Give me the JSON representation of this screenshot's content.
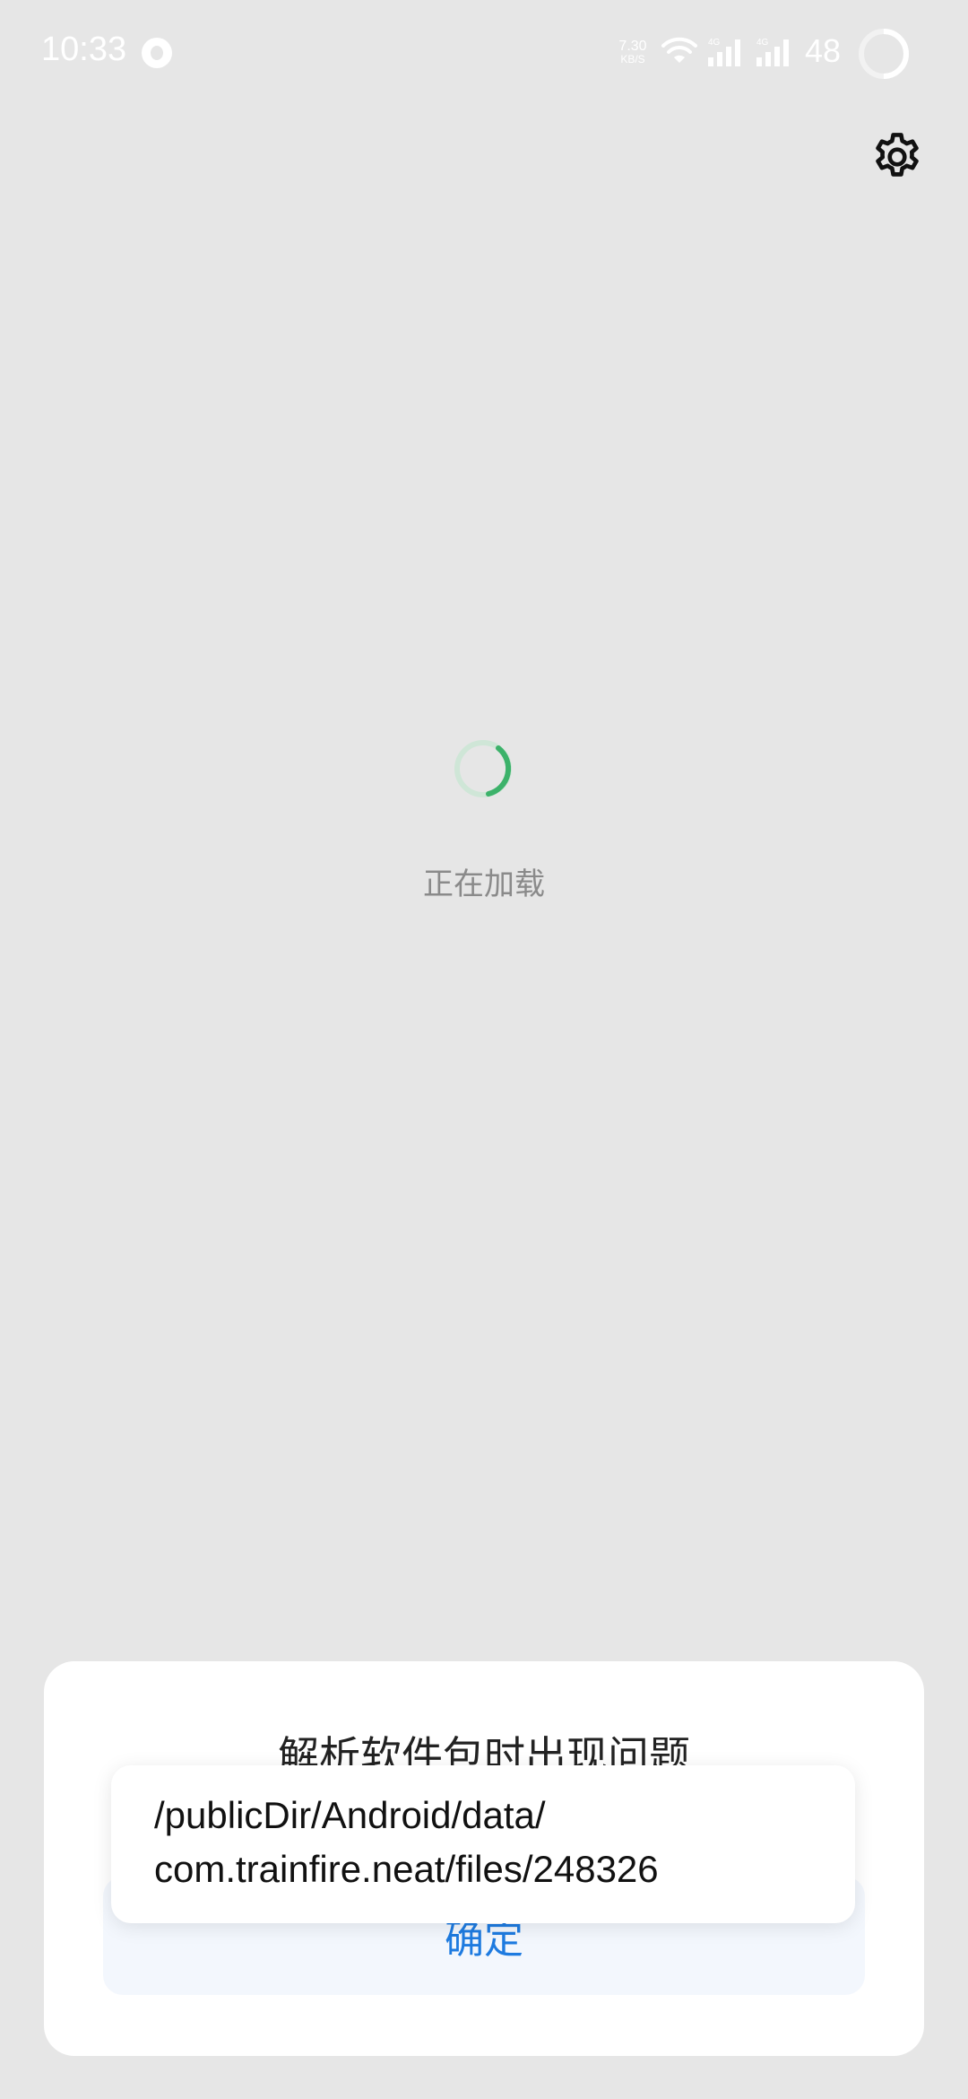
{
  "status_bar": {
    "time": "10:33",
    "net_speed_value": "7.30",
    "net_speed_unit": "KB/S",
    "signal_1_label": "4G",
    "signal_2_label": "4G",
    "battery": "48"
  },
  "loading": {
    "text": "正在加载",
    "spinner_color": "#3cb26a"
  },
  "dialog": {
    "title": "解析软件包时出现问题",
    "confirm_label": "确定",
    "confirm_color": "#1e7be0"
  },
  "toast": {
    "path_line_1": "/publicDir/Android/data/",
    "path_line_2": "com.trainfire.neat/files/248326"
  },
  "icons": {
    "settings": "gear-icon",
    "wifi": "wifi-icon",
    "signal": "signal-icon",
    "battery": "battery-ring-icon"
  }
}
